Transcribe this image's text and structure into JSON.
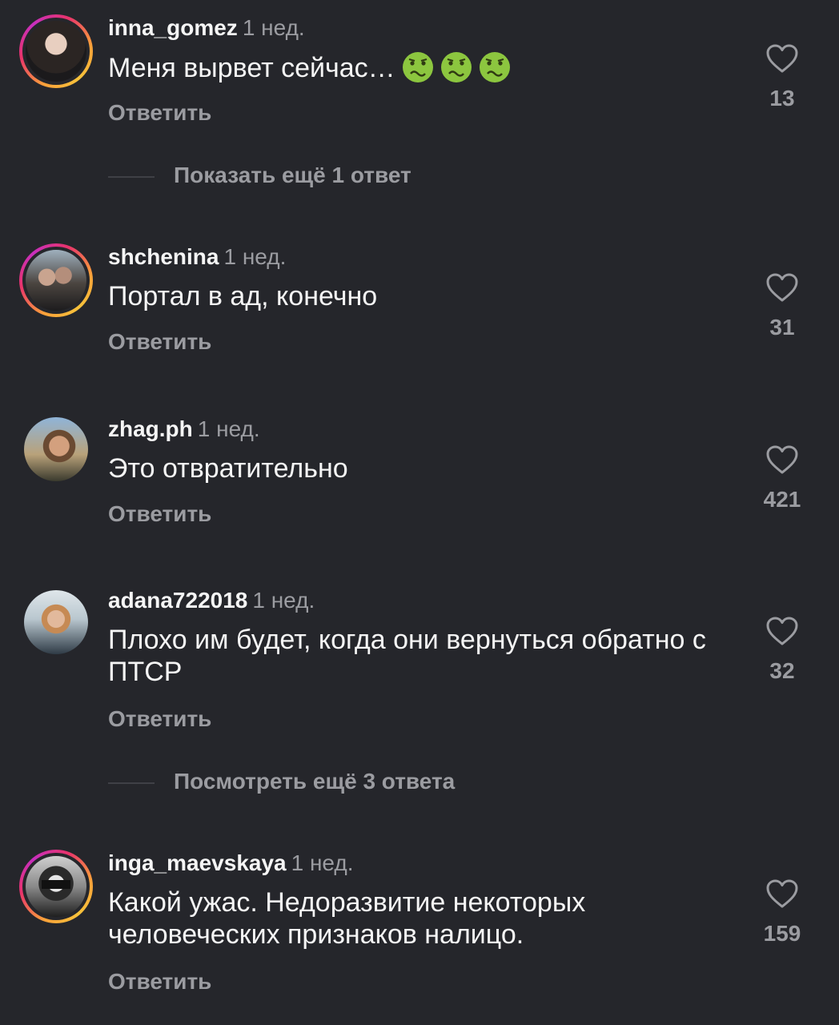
{
  "colors": {
    "background": "#25262b",
    "primary_text": "#f5f5f5",
    "secondary_text": "#9b9ca1",
    "story_ring": [
      "#f9a13a",
      "#e8336b",
      "#c72fbf"
    ]
  },
  "comments": [
    {
      "username": "inna_gomez",
      "time": "1 нед.",
      "text": "Меня вырвет сейчас…",
      "emojis": [
        "nauseated-face",
        "nauseated-face",
        "nauseated-face"
      ],
      "reply_label": "Ответить",
      "likes": "13",
      "has_story_ring": true
    },
    {
      "username": "shchenina",
      "time": "1 нед.",
      "text": "Портал в ад, конечно",
      "reply_label": "Ответить",
      "likes": "31",
      "has_story_ring": true
    },
    {
      "username": "zhag.ph",
      "time": "1 нед.",
      "text": "Это отвратительно",
      "reply_label": "Ответить",
      "likes": "421",
      "has_story_ring": false
    },
    {
      "username": "adana722018",
      "time": "1 нед.",
      "text": "Плохо им будет, когда они вернуться обратно с ПТСР",
      "reply_label": "Ответить",
      "likes": "32",
      "has_story_ring": false
    },
    {
      "username": "inga_maevskaya",
      "time": "1 нед.",
      "text": "Какой ужас. Недоразвитие некоторых человеческих признаков налицо.",
      "reply_label": "Ответить",
      "likes": "159",
      "has_story_ring": true
    }
  ],
  "thread_links": [
    {
      "label": "Показать ещё 1 ответ"
    },
    {
      "label": "Посмотреть ещё 3 ответа"
    }
  ],
  "icons": {
    "like": "heart-outline-icon",
    "emoji": "nauseated-face-emoji"
  }
}
